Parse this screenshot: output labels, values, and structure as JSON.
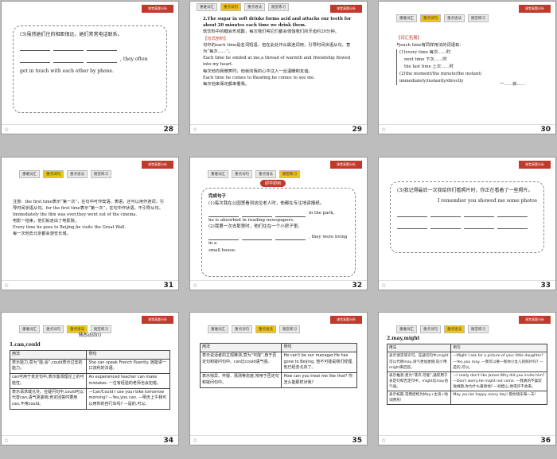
{
  "tabs": [
    "重难词汇",
    "重点词句",
    "重点语法",
    "随堂练习"
  ],
  "brand": "课堂真题分析",
  "star": "☆",
  "slides": [
    {
      "page": "28",
      "active": 1,
      "lines": [
        "(3)虽然她们住的相距很远，她们常常电话联系。",
        ", they often",
        "get in touch with each other by phone."
      ]
    },
    {
      "page": "29",
      "active": 1,
      "lines": [
        "2.The sugar in soft drinks forms acid and attacks our teeth for about 20 minutes each time we drink them.",
        "软饮料中的糖会形成酸，每次我们喝它们都会侵蚀我们的牙齿约20分钟。",
        "【句式剖析】",
        "句中的each time是名词短语，但在此处作从属连词用，引导时间状语从句，意为“每次……”。",
        "Each time he smiled at me,a thread of warmth and friendship flowed into my heart.",
        "每次他向我微笑时，他就向我的心中注入一丝温暖和友谊。",
        "Each time he comes to Baoding,he comes to see me.",
        "每次他来保定都来看我。"
      ]
    },
    {
      "page": "30",
      "active": 1,
      "lines": [
        "【词汇拓展】",
        "与each time有同样用法的词语有：",
        "(1)every time 每次……时",
        "next time 下次……时",
        "the last time 上次……时",
        "(2)the moment/the minute/the instant/",
        "immediately/instantly/directly",
        "一……就……"
      ]
    },
    {
      "page": "31",
      "active": 1,
      "lines": [
        "注意：the first time表示“第一次”，在句中可作宾语。表语，还可以用作连词，引导时间状语从句。for the first time表示“第一次”，在句中作状语，不引导从句。",
        "Immediately the film was over,they went out of the cinema.",
        "电影一结束，他们就走出了电影院。",
        "Every time he goes to Beijing,he visits the Great Wall.",
        "每一次他去北京都会游览长城。"
      ]
    },
    {
      "page": "32",
      "active": 3,
      "badge": "即学即用",
      "lines": [
        "完成句子",
        "(1)每次我在公园里看到这位老人时，他都在专注地读报纸。",
        "in the park,",
        "he is absorbed in reading newspapers.",
        "(2)我第一次去那里时，他们住在一个小房子里。",
        ", they were living in a",
        "small house."
      ]
    },
    {
      "page": "33",
      "active": 1,
      "lines": [
        "(3)我记得最后一次我给你们看照片时，你正在看着了一些照片。",
        "I remember you showed me some photos"
      ]
    },
    {
      "page": "34",
      "active": 2,
      "title": "情态动词(Ⅰ)",
      "subtitle": "1.can,could",
      "table_head": [
        "用法",
        "例句"
      ],
      "rows": [
        [
          "表示能力,意为“能,会”,could表示过去的能力。",
          "She can speak French fluently. 她能讲一口流利的法语。"
        ],
        [
          "can可用于肯定句中,表示客观理论上的可能性。",
          "An experienced teacher can make mistakes. 一位有经验的老师也会犯错。"
        ],
        [
          "表示请求或允许。在疑问句中,could可以代替can,语气更委婉;肯定回答时要用can,不用could。",
          "—Can/Could I use your bike tomorrow morning? —Yes,you can. —明天上午我可以用你的自行车吗? —是的,可以。"
        ]
      ]
    },
    {
      "page": "35",
      "active": 2,
      "table_head": [
        "用法",
        "例句"
      ],
      "rows": [
        [
          "表示说话者的主观推测,意为“可能”,用于否定句和疑问句中。can比could语气强。",
          "He can't be our manager.He has gone to Beijing. 他不可能是我们经理,他已经去北京了。"
        ],
        [
          "表示惊异、怀疑、猜测等态度,常用于否定句和疑问句中。",
          "How can you treat me like that? 你怎么能那样对我?"
        ]
      ]
    },
    {
      "page": "36",
      "active": 2,
      "subtitle": "2.may,might",
      "table_head": [
        "用法",
        "例句"
      ],
      "rows": [
        [
          "表示请求或许可。在疑问句中,might可以代替may,语气更加委婉,较少用might来回答。",
          "—Might I ask for a picture of your little daughter? —Yes,you may. —我可以要一张你小女儿的照片吗? —是的,可以。"
        ],
        [
          "表示推测,意为“或许,可能”,通常用于肯定句和否定句中。might比may语气弱。",
          "—I really don't like James.Why did you invite him? —Don't worry.He might not come. —我真的不喜欢詹姆斯,你为什么邀请他? —别担心,他或许不会来。"
        ],
        [
          "表示祝愿,常用结构为May+主语+动词原形!",
          "May you be happy every day! 愿你快乐每一天!"
        ]
      ]
    }
  ]
}
